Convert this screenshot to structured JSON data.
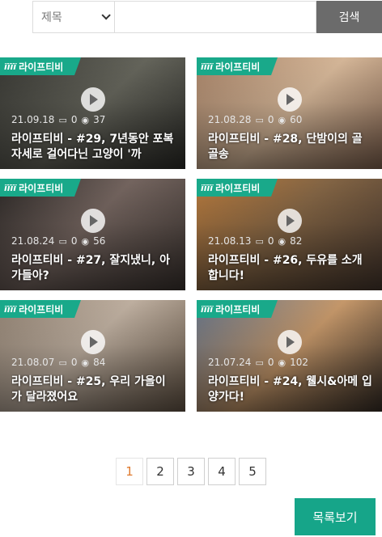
{
  "search": {
    "select_value": "제목",
    "input_value": "",
    "input_placeholder": "",
    "button_label": "검색"
  },
  "brand_label": "라이프티비",
  "videos": [
    {
      "date": "21.09.18",
      "comments": "0",
      "views": "37",
      "title": "라이프티비 - #29, 7년동안 포복자세로 걸어다닌 고양이 '까",
      "bg": "#4a4a44"
    },
    {
      "date": "21.08.28",
      "comments": "0",
      "views": "60",
      "title": "라이프티비 - #28, 단밤이의 골골송",
      "bg": "#8a6a55"
    },
    {
      "date": "21.08.24",
      "comments": "0",
      "views": "56",
      "title": "라이프티비 - #27, 잘지냈니, 아가들아?",
      "bg": "#5a4a44"
    },
    {
      "date": "21.08.13",
      "comments": "0",
      "views": "82",
      "title": "라이프티비 - #26, 두유를 소개합니다!",
      "bg": "#6e5a40"
    },
    {
      "date": "21.08.07",
      "comments": "0",
      "views": "84",
      "title": "라이프티비 - #25, 우리 가을이가 달라졌어요",
      "bg": "#7a6a5a"
    },
    {
      "date": "21.07.24",
      "comments": "0",
      "views": "102",
      "title": "라이프티비 - #24, 웰시&아메 입양가다!",
      "bg": "#5e6a7a"
    }
  ],
  "pagination": {
    "pages": [
      "1",
      "2",
      "3",
      "4",
      "5"
    ],
    "current": "1"
  },
  "list_button_label": "목록보기",
  "colors": {
    "brand": "#19a98a",
    "search_button": "#6b6b6b",
    "active_page": "#e07a2e",
    "list_button": "#16a589"
  }
}
